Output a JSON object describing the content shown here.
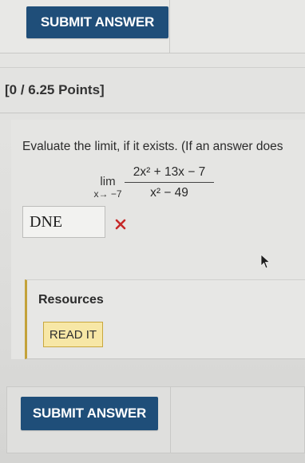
{
  "top": {
    "submit_label": "SUBMIT ANSWER"
  },
  "question": {
    "points": "[0 / 6.25 Points]",
    "prompt": "Evaluate the limit, if it exists. (If an answer does",
    "limit": {
      "word": "lim",
      "subscript": "x→ −7",
      "numerator": "2x² + 13x − 7",
      "denominator": "x² − 49"
    },
    "answer_value": "DNE",
    "answer_status": "incorrect"
  },
  "resources": {
    "title": "Resources",
    "read_it_label": "READ IT"
  },
  "bottom": {
    "submit_label": "SUBMIT ANSWER"
  },
  "colors": {
    "primary_button": "#1f4e79",
    "read_it_button": "#f7e7a6",
    "incorrect_mark": "#c62828"
  }
}
